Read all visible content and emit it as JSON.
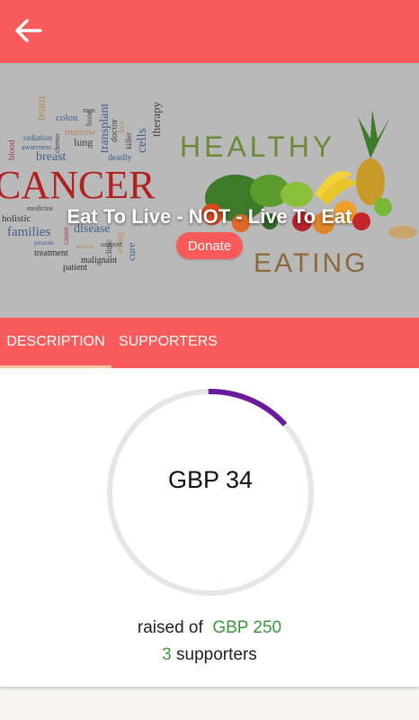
{
  "header": {
    "back_icon": "arrow-left-icon",
    "background": "#f95b5b"
  },
  "hero": {
    "title": "Eat To Live - NOT - Live To Eat",
    "donate_label": "Donate",
    "image": {
      "cancer_word": "CANCER",
      "cloud_words": [
        "team",
        "men",
        "bone",
        "colon",
        "transplant",
        "radiation",
        "chemo",
        "marrow",
        "doctor",
        "cells",
        "therapy",
        "blood",
        "awareness",
        "lung",
        "killer",
        "live",
        "breast",
        "deadly",
        "medicine",
        "holistic",
        "families",
        "disease",
        "clinic",
        "testing",
        "cure",
        "women",
        "support",
        "prostate",
        "cause",
        "treatment",
        "malignant",
        "patient"
      ],
      "healthy_word": "HEALTHY",
      "eating_word": "EATING"
    }
  },
  "tabs": [
    {
      "label": "DESCRIPTION",
      "active": true
    },
    {
      "label": "SUPPORTERS",
      "active": false
    }
  ],
  "funding": {
    "raised_amount": "GBP 34",
    "raised_prefix": "raised of",
    "goal": "GBP 250",
    "supporters_count": "3",
    "supporters_label": "supporters",
    "progress_fraction": 0.136,
    "progress_color": "#6a1b9a",
    "track_color": "#e6e6e6"
  }
}
